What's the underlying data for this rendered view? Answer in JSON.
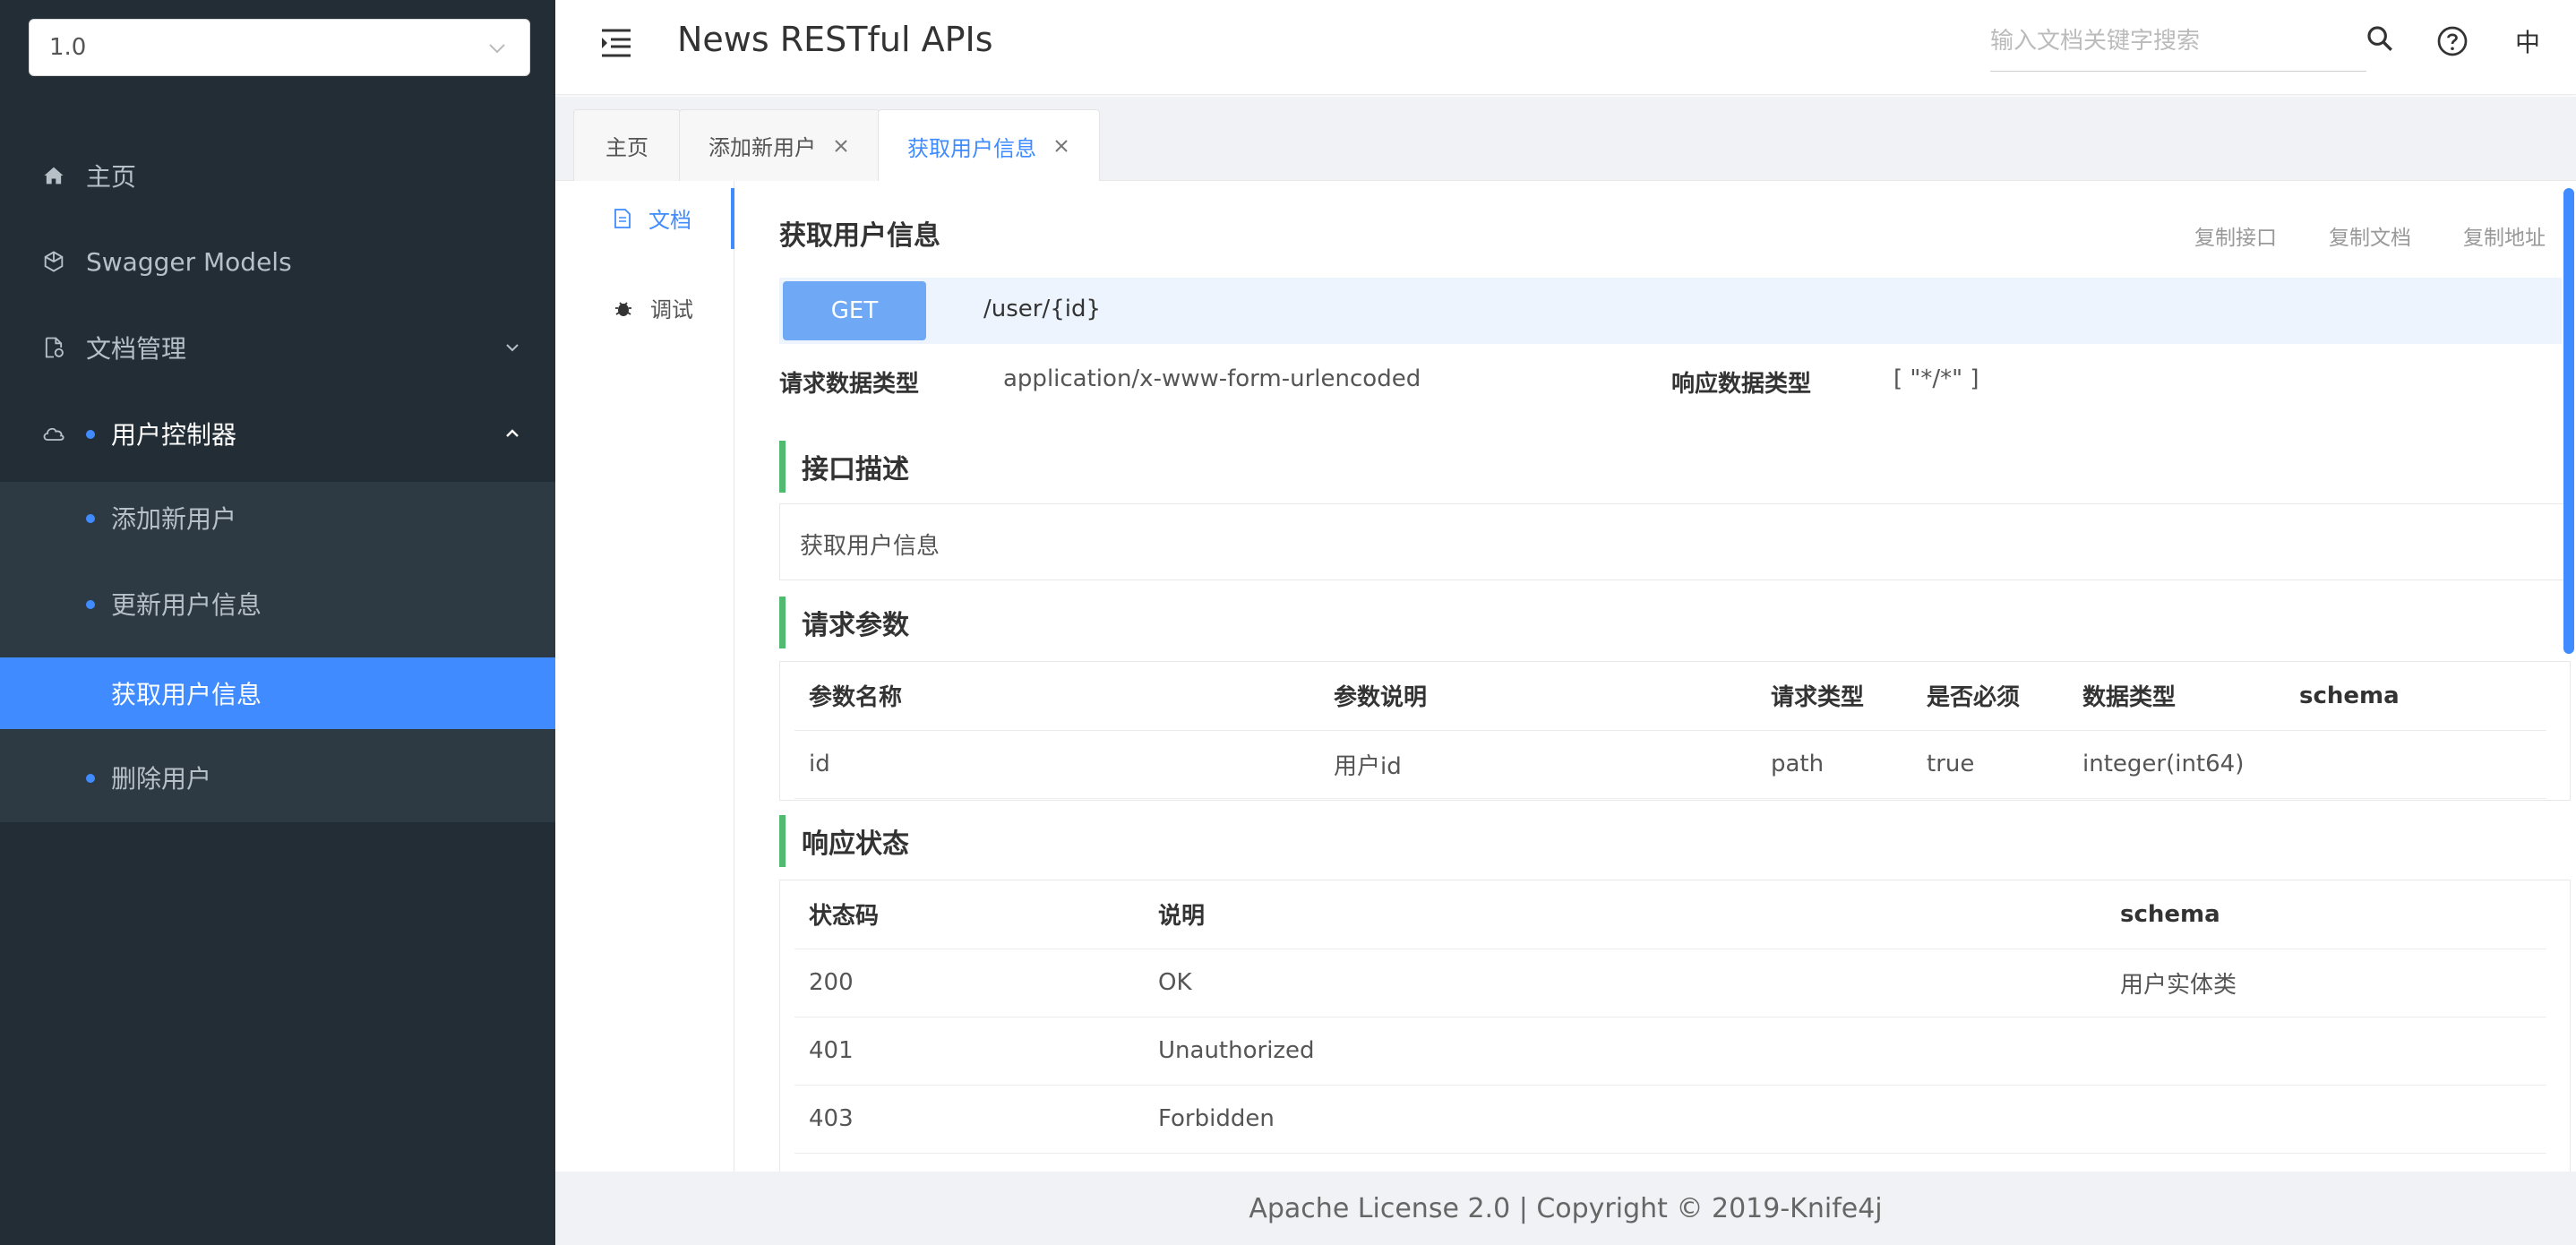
{
  "sidebar": {
    "version": "1.0",
    "items": [
      {
        "label": "主页"
      },
      {
        "label": "Swagger Models"
      },
      {
        "label": "文档管理"
      },
      {
        "label": "用户控制器"
      }
    ],
    "subitems": [
      {
        "label": "添加新用户"
      },
      {
        "label": "更新用户信息"
      },
      {
        "label": "获取用户信息"
      },
      {
        "label": "删除用户"
      }
    ]
  },
  "header": {
    "title": "News RESTful APIs",
    "search_placeholder": "输入文档关键字搜索",
    "lang": "中"
  },
  "tabs": [
    {
      "label": "主页"
    },
    {
      "label": "添加新用户"
    },
    {
      "label": "获取用户信息"
    }
  ],
  "side_tabs": [
    {
      "label": "文档"
    },
    {
      "label": "调试"
    }
  ],
  "doc": {
    "title": "获取用户信息",
    "actions": [
      "复制接口",
      "复制文档",
      "复制地址"
    ],
    "method": "GET",
    "path": "/user/{id}",
    "request_type_label": "请求数据类型",
    "request_type": "application/x-www-form-urlencoded",
    "response_type_label": "响应数据类型",
    "response_type": "[ \"*/*\" ]",
    "desc_title": "接口描述",
    "description": "获取用户信息",
    "params_title": "请求参数",
    "params_headers": [
      "参数名称",
      "参数说明",
      "请求类型",
      "是否必须",
      "数据类型",
      "schema"
    ],
    "params_rows": [
      [
        "id",
        "用户id",
        "path",
        "true",
        "integer(int64)",
        ""
      ]
    ],
    "status_title": "响应状态",
    "status_headers": [
      "状态码",
      "说明",
      "schema"
    ],
    "status_rows": [
      [
        "200",
        "OK",
        "用户实体类"
      ],
      [
        "401",
        "Unauthorized",
        ""
      ],
      [
        "403",
        "Forbidden",
        ""
      ]
    ]
  },
  "footer": {
    "text": "Apache License 2.0 | Copyright © 2019-Knife4j"
  },
  "colors": {
    "sidebar_bg": "#232d35",
    "submenu_bg": "#2d3943",
    "accent": "#3f8bff",
    "method_badge": "#6fa9f5",
    "section_bar": "#52b970",
    "required": "#e74c3c"
  }
}
